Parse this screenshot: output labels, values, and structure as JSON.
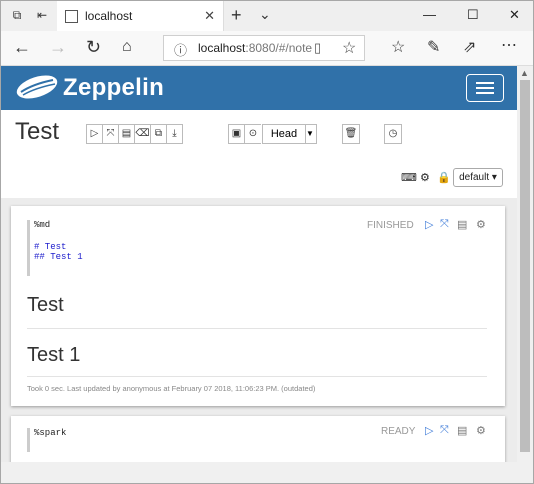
{
  "browser": {
    "tab_title": "localhost",
    "tab_close": "✕",
    "new_tab": "+",
    "tab_list": "⌄",
    "window_controls": [
      "—",
      "☐",
      "✕"
    ],
    "url_host": "localhost",
    "url_rest": ":8080/#/note"
  },
  "app": {
    "title": "Zeppelin"
  },
  "note": {
    "title": "Test",
    "head_label": "Head",
    "interpreter_label": "default ▾"
  },
  "paragraphs": [
    {
      "code_line1": "%md",
      "code_line2": "# Test",
      "code_line3": "## Test 1",
      "status": "FINISHED",
      "output_h1": "Test",
      "output_h2": "Test 1",
      "footer": "Took 0 sec. Last updated by anonymous at February 07 2018, 11:06:23 PM. (outdated)"
    },
    {
      "code_line1": "%spark",
      "status": "READY"
    }
  ],
  "colors": {
    "header_bg": "#3071a9",
    "run_icon": "#3e7bd8"
  }
}
